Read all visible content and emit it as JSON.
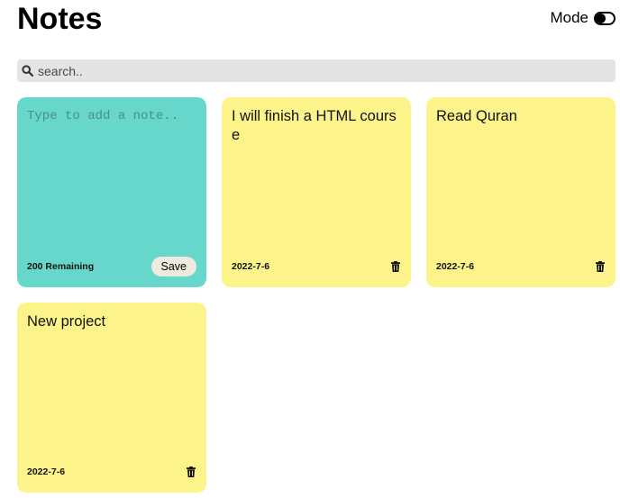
{
  "header": {
    "title": "Notes",
    "mode_label": "Mode"
  },
  "search": {
    "placeholder": "search..",
    "value": "",
    "icon": "search-icon"
  },
  "new_note": {
    "placeholder": "Type to add a note..",
    "remaining_text": "200 Remaining",
    "save_label": "Save",
    "color": "#67d7cc"
  },
  "notes": [
    {
      "text": "I will finish a  HTML course",
      "date": "2022-7-6"
    },
    {
      "text": "Read Quran",
      "date": "2022-7-6"
    },
    {
      "text": "New project",
      "date": "2022-7-6"
    }
  ],
  "colors": {
    "note_yellow": "#fcf38a",
    "search_bg": "#e5e3e3",
    "save_button_bg": "#efeae0"
  }
}
